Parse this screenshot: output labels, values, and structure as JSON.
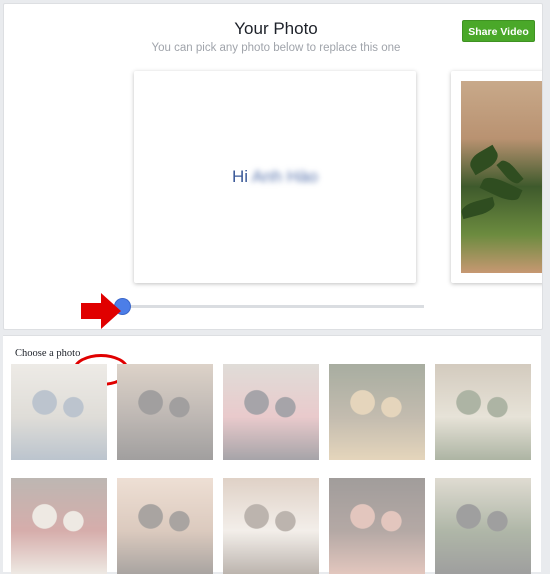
{
  "header": {
    "title": "Your Photo",
    "subtitle": "You can pick any photo below to replace this one",
    "share_button": "Share Video"
  },
  "preview": {
    "greeting": "Hi",
    "name_blurred": "Anh Hào"
  },
  "slider": {
    "position": 0
  },
  "chooser": {
    "label": "Choose a photo",
    "thumbnails": [
      {
        "name": "thumb-1",
        "colors": [
          "#b8b3a8",
          "#6a7d92",
          "#d8d2c8"
        ]
      },
      {
        "name": "thumb-2",
        "colors": [
          "#6f6158",
          "#2f2b2a",
          "#b39c86"
        ]
      },
      {
        "name": "thumb-3",
        "colors": [
          "#cf8a8e",
          "#3b3640",
          "#b9b2a8"
        ]
      },
      {
        "name": "thumb-4",
        "colors": [
          "#7a6a4e",
          "#c5a36a",
          "#3e4a2e"
        ]
      },
      {
        "name": "thumb-5",
        "colors": [
          "#c9c0a8",
          "#4a5a35",
          "#9e8b70"
        ]
      },
      {
        "name": "thumb-6",
        "colors": [
          "#a44a45",
          "#d9cfc2",
          "#6d5f55"
        ]
      },
      {
        "name": "thumb-7",
        "colors": [
          "#b08a70",
          "#40362f",
          "#d9b8a0"
        ]
      },
      {
        "name": "thumb-8",
        "colors": [
          "#e4dad0",
          "#6b5a4c",
          "#b99a82"
        ]
      },
      {
        "name": "thumb-9",
        "colors": [
          "#5a4038",
          "#c0826f",
          "#2f2622"
        ]
      },
      {
        "name": "thumb-10",
        "colors": [
          "#4f5f3e",
          "#2a2a2a",
          "#b8b09a"
        ]
      }
    ]
  },
  "colors": {
    "accent": "#4aa829",
    "slider_knob": "#4c7ee8",
    "annotation": "#e00000"
  }
}
